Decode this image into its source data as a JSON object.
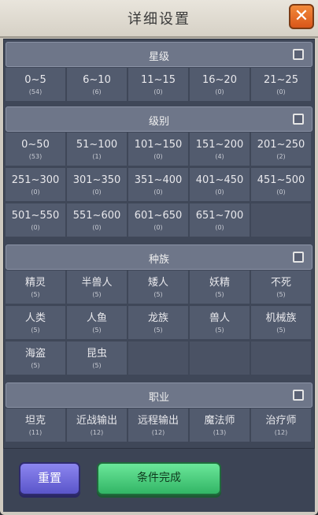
{
  "dialog": {
    "title": "详细设置",
    "close_label": "✕"
  },
  "sections": {
    "star": {
      "title": "星级",
      "items": [
        {
          "label": "0~5",
          "count": "(54)"
        },
        {
          "label": "6~10",
          "count": "(6)"
        },
        {
          "label": "11~15",
          "count": "(0)"
        },
        {
          "label": "16~20",
          "count": "(0)"
        },
        {
          "label": "21~25",
          "count": "(0)"
        }
      ]
    },
    "level": {
      "title": "级别",
      "items": [
        {
          "label": "0~50",
          "count": "(53)"
        },
        {
          "label": "51~100",
          "count": "(1)"
        },
        {
          "label": "101~150",
          "count": "(0)"
        },
        {
          "label": "151~200",
          "count": "(4)"
        },
        {
          "label": "201~250",
          "count": "(2)"
        },
        {
          "label": "251~300",
          "count": "(0)"
        },
        {
          "label": "301~350",
          "count": "(0)"
        },
        {
          "label": "351~400",
          "count": "(0)"
        },
        {
          "label": "401~450",
          "count": "(0)"
        },
        {
          "label": "451~500",
          "count": "(0)"
        },
        {
          "label": "501~550",
          "count": "(0)"
        },
        {
          "label": "551~600",
          "count": "(0)"
        },
        {
          "label": "601~650",
          "count": "(0)"
        },
        {
          "label": "651~700",
          "count": "(0)"
        }
      ]
    },
    "race": {
      "title": "种族",
      "items": [
        {
          "label": "精灵",
          "count": "(5)"
        },
        {
          "label": "半兽人",
          "count": "(5)"
        },
        {
          "label": "矮人",
          "count": "(5)"
        },
        {
          "label": "妖精",
          "count": "(5)"
        },
        {
          "label": "不死",
          "count": "(5)"
        },
        {
          "label": "人类",
          "count": "(5)"
        },
        {
          "label": "人鱼",
          "count": "(5)"
        },
        {
          "label": "龙族",
          "count": "(5)"
        },
        {
          "label": "兽人",
          "count": "(5)"
        },
        {
          "label": "机械族",
          "count": "(5)"
        },
        {
          "label": "海盗",
          "count": "(5)"
        },
        {
          "label": "昆虫",
          "count": "(5)"
        }
      ]
    },
    "job": {
      "title": "职业",
      "items": [
        {
          "label": "坦克",
          "count": "(11)"
        },
        {
          "label": "近战输出",
          "count": "(12)"
        },
        {
          "label": "远程输出",
          "count": "(12)"
        },
        {
          "label": "魔法师",
          "count": "(13)"
        },
        {
          "label": "治疗师",
          "count": "(12)"
        }
      ]
    }
  },
  "buttons": {
    "reset": "重置",
    "done": "条件完成"
  }
}
